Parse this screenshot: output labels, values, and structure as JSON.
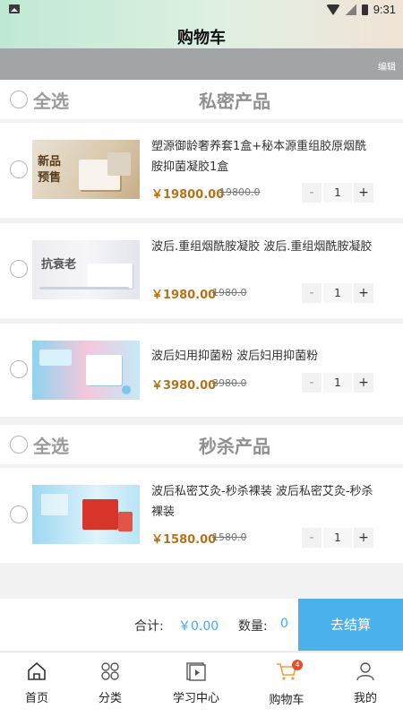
{
  "status_bar": {
    "time": "9:31"
  },
  "header": {
    "title": "购物车",
    "edit_label": "编辑"
  },
  "sections": [
    {
      "select_all": "全选",
      "title": "私密产品",
      "items": [
        {
          "name": "塑源御龄奢养套1盒+秘本源重组胶原烟酰胺抑菌凝胶1盒",
          "price": "￥19800.00",
          "original_price": "19800.0",
          "quantity": "1",
          "thumb_text": "新品\n预售"
        },
        {
          "name": "波后.重组烟酰胺凝胶 波后.重组烟酰胺凝胶",
          "price": "￥1980.00",
          "original_price": "1980.0",
          "quantity": "1",
          "thumb_text": "抗衰老"
        },
        {
          "name": "波后妇用抑菌粉 波后妇用抑菌粉",
          "price": "￥3980.00",
          "original_price": "3980.0",
          "quantity": "1",
          "thumb_text": ""
        }
      ]
    },
    {
      "select_all": "全选",
      "title": "秒杀产品",
      "items": [
        {
          "name": "波后私密艾灸-秒杀裸装 波后私密艾灸-秒杀裸装",
          "price": "￥1580.00",
          "original_price": "1580.0",
          "quantity": "1",
          "thumb_text": ""
        }
      ]
    }
  ],
  "stepper": {
    "minus": "-",
    "plus": "+"
  },
  "footer": {
    "total_label": "合计:",
    "total_value": "￥0.00",
    "count_label": "数量:",
    "count_value": "0",
    "checkout_label": "去结算"
  },
  "tabs": [
    {
      "label": "首页",
      "icon": "home-icon"
    },
    {
      "label": "分类",
      "icon": "category-icon"
    },
    {
      "label": "学习中心",
      "icon": "learning-icon"
    },
    {
      "label": "购物车",
      "icon": "cart-icon",
      "badge": "4"
    },
    {
      "label": "我的",
      "icon": "profile-icon"
    }
  ]
}
